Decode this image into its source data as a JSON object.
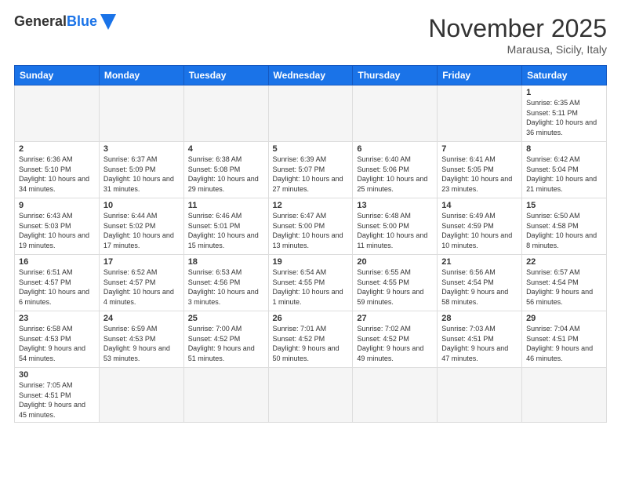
{
  "header": {
    "logo_general": "General",
    "logo_blue": "Blue",
    "month_title": "November 2025",
    "location": "Marausa, Sicily, Italy"
  },
  "days_of_week": [
    "Sunday",
    "Monday",
    "Tuesday",
    "Wednesday",
    "Thursday",
    "Friday",
    "Saturday"
  ],
  "weeks": [
    [
      {
        "day": "",
        "info": ""
      },
      {
        "day": "",
        "info": ""
      },
      {
        "day": "",
        "info": ""
      },
      {
        "day": "",
        "info": ""
      },
      {
        "day": "",
        "info": ""
      },
      {
        "day": "",
        "info": ""
      },
      {
        "day": "1",
        "info": "Sunrise: 6:35 AM\nSunset: 5:11 PM\nDaylight: 10 hours and 36 minutes."
      }
    ],
    [
      {
        "day": "2",
        "info": "Sunrise: 6:36 AM\nSunset: 5:10 PM\nDaylight: 10 hours and 34 minutes."
      },
      {
        "day": "3",
        "info": "Sunrise: 6:37 AM\nSunset: 5:09 PM\nDaylight: 10 hours and 31 minutes."
      },
      {
        "day": "4",
        "info": "Sunrise: 6:38 AM\nSunset: 5:08 PM\nDaylight: 10 hours and 29 minutes."
      },
      {
        "day": "5",
        "info": "Sunrise: 6:39 AM\nSunset: 5:07 PM\nDaylight: 10 hours and 27 minutes."
      },
      {
        "day": "6",
        "info": "Sunrise: 6:40 AM\nSunset: 5:06 PM\nDaylight: 10 hours and 25 minutes."
      },
      {
        "day": "7",
        "info": "Sunrise: 6:41 AM\nSunset: 5:05 PM\nDaylight: 10 hours and 23 minutes."
      },
      {
        "day": "8",
        "info": "Sunrise: 6:42 AM\nSunset: 5:04 PM\nDaylight: 10 hours and 21 minutes."
      }
    ],
    [
      {
        "day": "9",
        "info": "Sunrise: 6:43 AM\nSunset: 5:03 PM\nDaylight: 10 hours and 19 minutes."
      },
      {
        "day": "10",
        "info": "Sunrise: 6:44 AM\nSunset: 5:02 PM\nDaylight: 10 hours and 17 minutes."
      },
      {
        "day": "11",
        "info": "Sunrise: 6:46 AM\nSunset: 5:01 PM\nDaylight: 10 hours and 15 minutes."
      },
      {
        "day": "12",
        "info": "Sunrise: 6:47 AM\nSunset: 5:00 PM\nDaylight: 10 hours and 13 minutes."
      },
      {
        "day": "13",
        "info": "Sunrise: 6:48 AM\nSunset: 5:00 PM\nDaylight: 10 hours and 11 minutes."
      },
      {
        "day": "14",
        "info": "Sunrise: 6:49 AM\nSunset: 4:59 PM\nDaylight: 10 hours and 10 minutes."
      },
      {
        "day": "15",
        "info": "Sunrise: 6:50 AM\nSunset: 4:58 PM\nDaylight: 10 hours and 8 minutes."
      }
    ],
    [
      {
        "day": "16",
        "info": "Sunrise: 6:51 AM\nSunset: 4:57 PM\nDaylight: 10 hours and 6 minutes."
      },
      {
        "day": "17",
        "info": "Sunrise: 6:52 AM\nSunset: 4:57 PM\nDaylight: 10 hours and 4 minutes."
      },
      {
        "day": "18",
        "info": "Sunrise: 6:53 AM\nSunset: 4:56 PM\nDaylight: 10 hours and 3 minutes."
      },
      {
        "day": "19",
        "info": "Sunrise: 6:54 AM\nSunset: 4:55 PM\nDaylight: 10 hours and 1 minute."
      },
      {
        "day": "20",
        "info": "Sunrise: 6:55 AM\nSunset: 4:55 PM\nDaylight: 9 hours and 59 minutes."
      },
      {
        "day": "21",
        "info": "Sunrise: 6:56 AM\nSunset: 4:54 PM\nDaylight: 9 hours and 58 minutes."
      },
      {
        "day": "22",
        "info": "Sunrise: 6:57 AM\nSunset: 4:54 PM\nDaylight: 9 hours and 56 minutes."
      }
    ],
    [
      {
        "day": "23",
        "info": "Sunrise: 6:58 AM\nSunset: 4:53 PM\nDaylight: 9 hours and 54 minutes."
      },
      {
        "day": "24",
        "info": "Sunrise: 6:59 AM\nSunset: 4:53 PM\nDaylight: 9 hours and 53 minutes."
      },
      {
        "day": "25",
        "info": "Sunrise: 7:00 AM\nSunset: 4:52 PM\nDaylight: 9 hours and 51 minutes."
      },
      {
        "day": "26",
        "info": "Sunrise: 7:01 AM\nSunset: 4:52 PM\nDaylight: 9 hours and 50 minutes."
      },
      {
        "day": "27",
        "info": "Sunrise: 7:02 AM\nSunset: 4:52 PM\nDaylight: 9 hours and 49 minutes."
      },
      {
        "day": "28",
        "info": "Sunrise: 7:03 AM\nSunset: 4:51 PM\nDaylight: 9 hours and 47 minutes."
      },
      {
        "day": "29",
        "info": "Sunrise: 7:04 AM\nSunset: 4:51 PM\nDaylight: 9 hours and 46 minutes."
      }
    ],
    [
      {
        "day": "30",
        "info": "Sunrise: 7:05 AM\nSunset: 4:51 PM\nDaylight: 9 hours and 45 minutes."
      },
      {
        "day": "",
        "info": ""
      },
      {
        "day": "",
        "info": ""
      },
      {
        "day": "",
        "info": ""
      },
      {
        "day": "",
        "info": ""
      },
      {
        "day": "",
        "info": ""
      },
      {
        "day": "",
        "info": ""
      }
    ]
  ]
}
